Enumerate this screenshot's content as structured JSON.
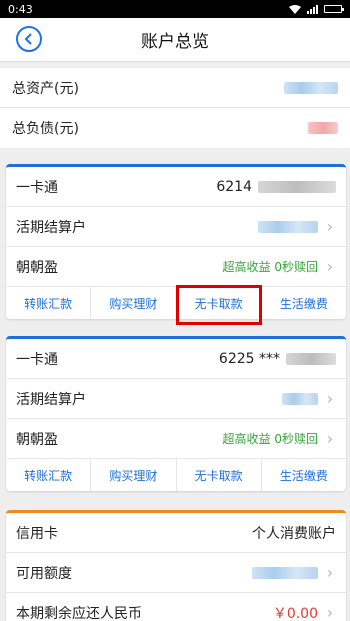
{
  "status": {
    "time": "0:43"
  },
  "nav": {
    "title": "账户总览",
    "back_icon": "back-icon"
  },
  "summary": {
    "total_assets_label": "总资产(元)",
    "total_liabilities_label": "总负债(元)"
  },
  "cards": [
    {
      "title": "一卡通",
      "number": "6214",
      "rows": [
        {
          "label": "活期结算户",
          "value": ""
        },
        {
          "label": "朝朝盈",
          "value": "超高收益 0秒赎回"
        }
      ],
      "actions": [
        "转账汇款",
        "购买理财",
        "无卡取款",
        "生活缴费"
      ]
    },
    {
      "title": "一卡通",
      "number": "6225 ***",
      "rows": [
        {
          "label": "活期结算户",
          "value": ""
        },
        {
          "label": "朝朝盈",
          "value": "超高收益 0秒赎回"
        }
      ],
      "actions": [
        "转账汇款",
        "购买理财",
        "无卡取款",
        "生活缴费"
      ]
    }
  ],
  "credit": {
    "title": "信用卡",
    "type": "个人消费账户",
    "rows": [
      {
        "label": "可用额度",
        "value": ""
      },
      {
        "label": "本期剩余应还人民币",
        "value": "￥0.00"
      }
    ]
  },
  "colors": {
    "accent": "#1e6fd9",
    "credit_accent": "#f08a1c",
    "green": "#37a43a",
    "highlight": "#e10000"
  }
}
